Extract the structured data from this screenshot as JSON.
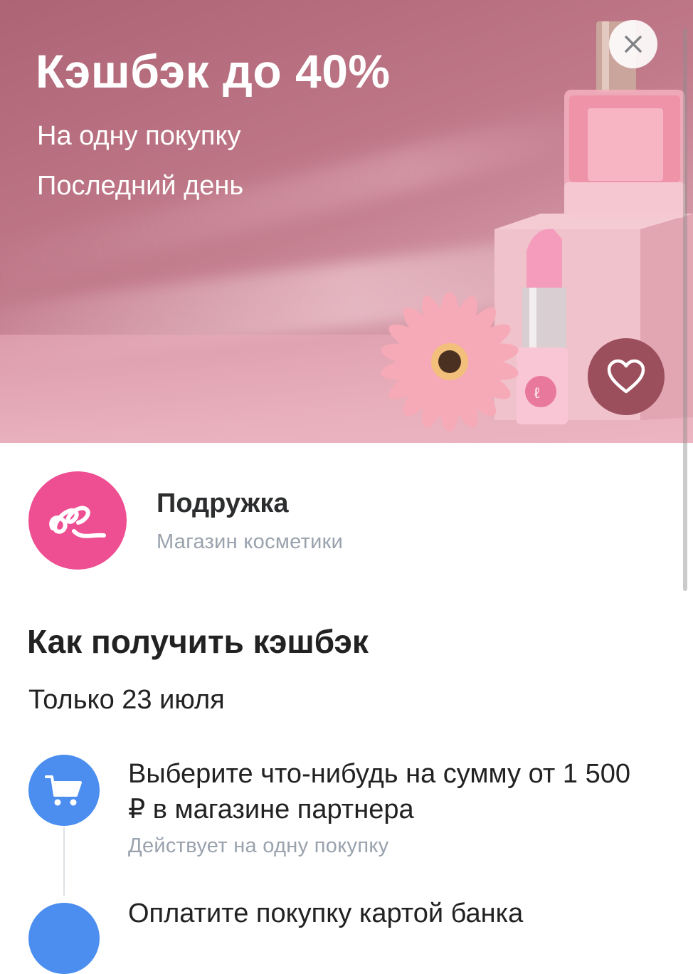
{
  "banner": {
    "title": "Кэшбэк до 40%",
    "subtitle_1": "На одну покупку",
    "subtitle_2": "Последний день"
  },
  "shop": {
    "name": "Подружка",
    "description": "Магазин косметики",
    "brand_color": "#ee4e92"
  },
  "how_to": {
    "title": "Как получить кэшбэк",
    "date": "Только 23 июля",
    "steps": [
      {
        "icon": "cart-icon",
        "title": "Выберите что-нибудь на сумму от 1 500 ₽ в магазине партнера",
        "note": "Действует на одну покупку"
      },
      {
        "icon": "step-icon",
        "title": "Оплатите покупку картой банка"
      }
    ]
  },
  "colors": {
    "banner": "#b86d7e",
    "accent": "#4b8ef0",
    "like_button": "#9b4e5b"
  }
}
